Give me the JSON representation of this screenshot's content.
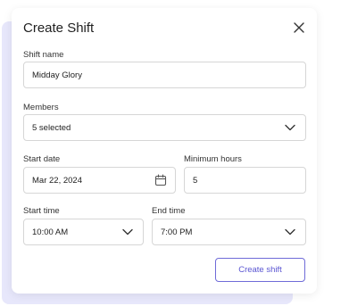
{
  "dialog": {
    "title": "Create Shift"
  },
  "form": {
    "shift_name": {
      "label": "Shift name",
      "value": "Midday Glory"
    },
    "members": {
      "label": "Members",
      "value": "5 selected"
    },
    "start_date": {
      "label": "Start date",
      "value": "Mar 22, 2024"
    },
    "minimum_hours": {
      "label": "Minimum hours",
      "value": "5"
    },
    "start_time": {
      "label": "Start time",
      "value": "10:00 AM"
    },
    "end_time": {
      "label": "End time",
      "value": "7:00 PM"
    }
  },
  "actions": {
    "create_label": "Create shift"
  },
  "colors": {
    "accent": "#5a55d2",
    "backdrop": "#e7e7fb"
  },
  "icons": {
    "close": "close-icon",
    "dropdown": "chevron-down-icon",
    "calendar": "calendar-icon"
  }
}
